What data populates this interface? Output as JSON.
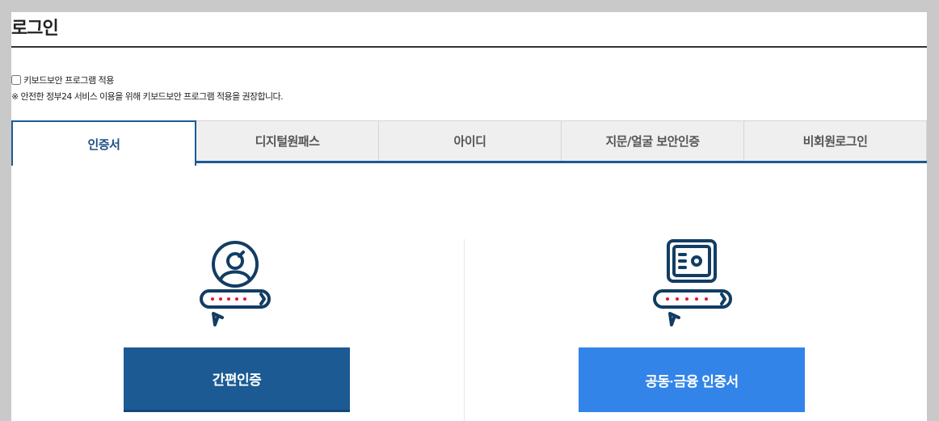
{
  "page": {
    "title": "로그인"
  },
  "keyboard_security": {
    "checkbox_label": "키보드보안 프로그램 적용",
    "checked": false,
    "notice": "※ 안전한 정부24 서비스 이용을 위해 키보드보안 프로그램 적용을 권장합니다."
  },
  "tabs": [
    {
      "label": "인증서",
      "active": true
    },
    {
      "label": "디지털원패스",
      "active": false
    },
    {
      "label": "아이디",
      "active": false
    },
    {
      "label": "지문/얼굴 보안인증",
      "active": false
    },
    {
      "label": "비회원로그인",
      "active": false
    }
  ],
  "options": {
    "simple": {
      "label": "간편인증",
      "icon": "user-password-icon"
    },
    "joint": {
      "label": "공동·금융 인증서",
      "icon": "safe-password-icon"
    }
  },
  "colors": {
    "navy": "#1b5a93",
    "blue": "#3384e8",
    "icon_stroke": "#123d63",
    "password_dot": "#e0163c"
  }
}
